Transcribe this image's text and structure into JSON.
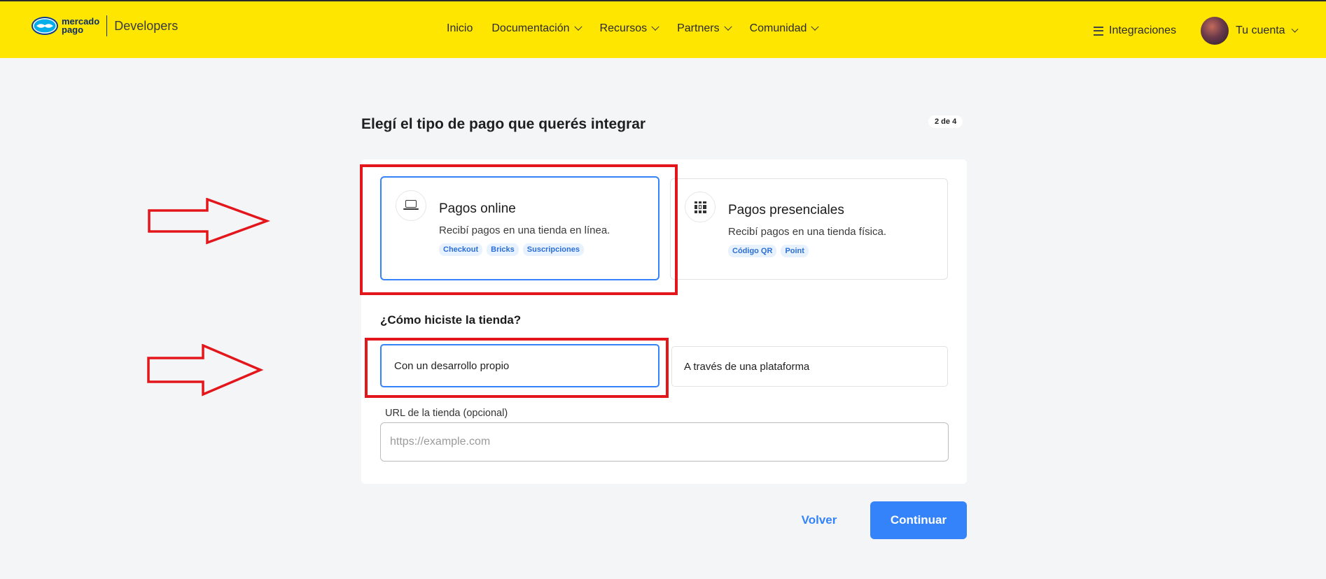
{
  "header": {
    "logo_line1": "mercado",
    "logo_line2": "pago",
    "logo_product": "Developers",
    "nav": [
      {
        "label": "Inicio",
        "has_dropdown": false
      },
      {
        "label": "Documentación",
        "has_dropdown": true
      },
      {
        "label": "Recursos",
        "has_dropdown": true
      },
      {
        "label": "Partners",
        "has_dropdown": true
      },
      {
        "label": "Comunidad",
        "has_dropdown": true
      }
    ],
    "integrations_label": "Integraciones",
    "account_label": "Tu cuenta"
  },
  "main": {
    "title": "Elegí el tipo de pago que querés integrar",
    "step_badge": "2 de 4",
    "cards": [
      {
        "title": "Pagos online",
        "description": "Recibí pagos en una tienda en línea.",
        "tags": [
          "Checkout",
          "Bricks",
          "Suscripciones"
        ],
        "icon": "laptop-icon",
        "selected": true
      },
      {
        "title": "Pagos presenciales",
        "description": "Recibí pagos en una tienda física.",
        "tags": [
          "Código QR",
          "Point"
        ],
        "icon": "qr-code-icon",
        "selected": false
      }
    ],
    "question": "¿Cómo hiciste la tienda?",
    "options": [
      {
        "label": "Con un desarrollo propio",
        "selected": true
      },
      {
        "label": "A través de una plataforma",
        "selected": false
      }
    ],
    "url_field": {
      "label": "URL de la tienda (opcional)",
      "placeholder": "https://example.com",
      "value": ""
    },
    "back_label": "Volver",
    "continue_label": "Continuar"
  },
  "colors": {
    "header_bg": "#ffe600",
    "accent": "#3483fa",
    "annotation_red": "#e3171b",
    "page_bg": "#f4f5f7"
  }
}
